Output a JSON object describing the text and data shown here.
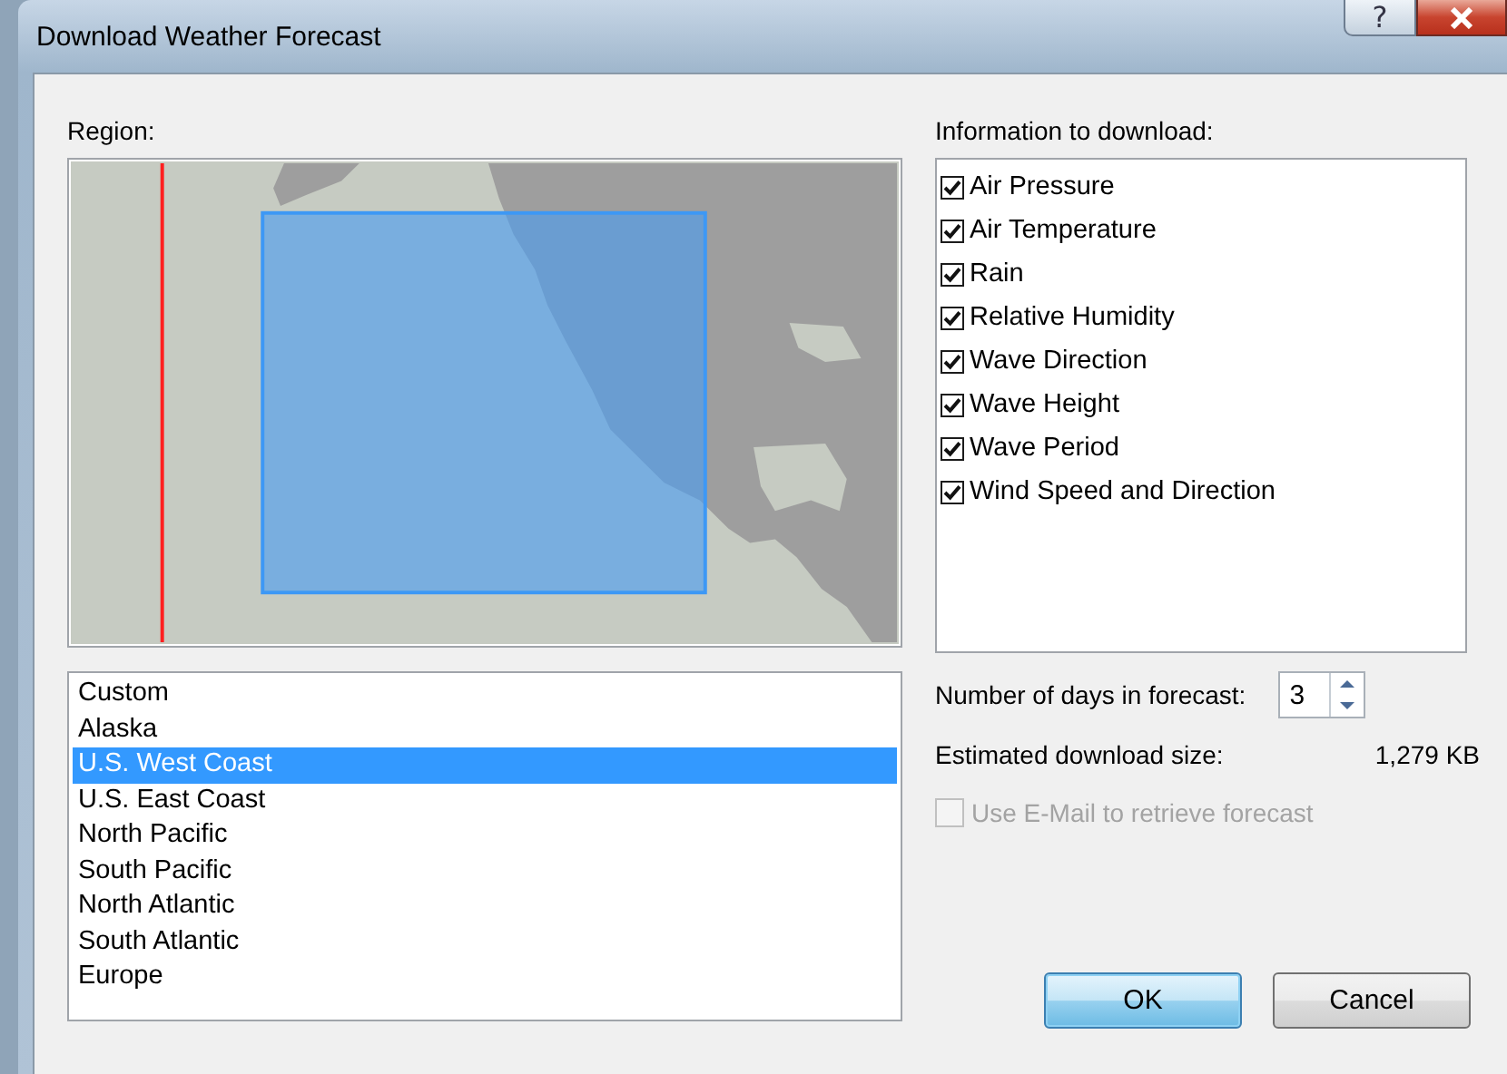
{
  "window": {
    "title": "Download Weather Forecast",
    "help": "?"
  },
  "region": {
    "label": "Region:",
    "items": [
      {
        "label": "Custom",
        "selected": false
      },
      {
        "label": "Alaska",
        "selected": false
      },
      {
        "label": "U.S. West Coast",
        "selected": true
      },
      {
        "label": "U.S. East Coast",
        "selected": false
      },
      {
        "label": "North Pacific",
        "selected": false
      },
      {
        "label": "South Pacific",
        "selected": false
      },
      {
        "label": "North Atlantic",
        "selected": false
      },
      {
        "label": "South Atlantic",
        "selected": false
      },
      {
        "label": "Europe",
        "selected": false
      }
    ]
  },
  "information": {
    "label": "Information to download:",
    "items": [
      {
        "label": "Air Pressure",
        "checked": true
      },
      {
        "label": "Air Temperature",
        "checked": true
      },
      {
        "label": "Rain",
        "checked": true
      },
      {
        "label": "Relative Humidity",
        "checked": true
      },
      {
        "label": "Wave Direction",
        "checked": true
      },
      {
        "label": "Wave Height",
        "checked": true
      },
      {
        "label": "Wave Period",
        "checked": true
      },
      {
        "label": "Wind Speed and Direction",
        "checked": true
      }
    ]
  },
  "days": {
    "label": "Number of days in forecast:",
    "value": "3"
  },
  "size": {
    "label": "Estimated download size:",
    "value": "1,279 KB"
  },
  "email": {
    "label": "Use E-Mail to retrieve forecast",
    "checked": false,
    "disabled": true
  },
  "buttons": [
    {
      "label": "OK",
      "default": true
    },
    {
      "label": "Cancel",
      "default": false
    }
  ]
}
